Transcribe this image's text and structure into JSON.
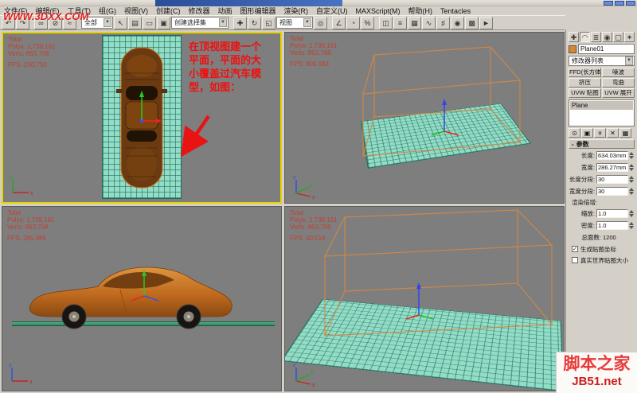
{
  "glyphs": {
    "dropdown_arrow": "▼"
  },
  "watermarks": {
    "top": "WWW.3DXX.COM",
    "bottom_title": "脚本之家",
    "bottom_sub": "JB51.net"
  },
  "menubar": {
    "items": [
      "文件(F)",
      "编辑(E)",
      "工具(T)",
      "组(G)",
      "视图(V)",
      "创建(C)",
      "修改器",
      "动画",
      "图形编辑器",
      "渲染(R)",
      "自定义(U)",
      "MAXScript(M)",
      "帮助(H)",
      "Tentacles"
    ]
  },
  "toolbar": {
    "selection_filter_value": "全部",
    "named_sets_placeholder": "创建选择集",
    "ref_coord_value": "视图",
    "icons": [
      {
        "name": "undo-icon",
        "glyph": "↶"
      },
      {
        "name": "redo-icon",
        "glyph": "↷"
      },
      {
        "name": "select-and-link-icon",
        "glyph": "∞"
      },
      {
        "name": "unlink-selection-icon",
        "glyph": "⊘"
      },
      {
        "name": "bind-to-space-warp-icon",
        "glyph": "≈"
      },
      {
        "name": "select-object-icon",
        "glyph": "↖"
      },
      {
        "name": "select-by-name-icon",
        "glyph": "▤"
      },
      {
        "name": "rectangular-selection-icon",
        "glyph": "▭"
      },
      {
        "name": "window-crossing-icon",
        "glyph": "▣"
      },
      {
        "name": "select-and-move-icon",
        "glyph": "✚"
      },
      {
        "name": "select-and-rotate-icon",
        "glyph": "↻"
      },
      {
        "name": "select-and-scale-icon",
        "glyph": "◱"
      },
      {
        "name": "use-pivot-center-icon",
        "glyph": "◎"
      },
      {
        "name": "snap-toggle-icon",
        "glyph": "∠"
      },
      {
        "name": "angle-snap-icon",
        "glyph": "◔"
      },
      {
        "name": "percent-snap-icon",
        "glyph": "%"
      },
      {
        "name": "mirror-icon",
        "glyph": "◫"
      },
      {
        "name": "align-icon",
        "glyph": "≡"
      },
      {
        "name": "layer-manager-icon",
        "glyph": "▦"
      },
      {
        "name": "curve-editor-icon",
        "glyph": "∿"
      },
      {
        "name": "schematic-view-icon",
        "glyph": "♯"
      },
      {
        "name": "material-editor-icon",
        "glyph": "◉"
      },
      {
        "name": "render-setup-icon",
        "glyph": "▩"
      },
      {
        "name": "quick-render-icon",
        "glyph": "►"
      }
    ]
  },
  "viewports": {
    "top": {
      "stats": [
        "Total",
        "Polys: 1,739,161",
        "Verts: 863,708"
      ],
      "fps": "FPS: 200.750",
      "annotation": [
        "在顶视图建一个",
        "平面，平面的大",
        "小覆盖过汽车模",
        "型，如图："
      ]
    },
    "perspective_upper": {
      "stats": [
        "Total",
        "Polys: 1,739,161",
        "Verts: 863,708"
      ],
      "fps": "FPS: 800.983"
    },
    "left": {
      "stats": [
        "Total",
        "Polys: 1,739,161",
        "Verts: 863,708"
      ],
      "fps": "FPS: 285.985"
    },
    "perspective_lower": {
      "stats": [
        "Total",
        "Polys: 1,739,161",
        "Verts: 863,708"
      ],
      "fps": "FPS: 40.518"
    }
  },
  "command_panel": {
    "tabs": [
      {
        "name": "create-tab-icon",
        "glyph": "✚"
      },
      {
        "name": "modify-tab-icon",
        "glyph": "◠"
      },
      {
        "name": "hierarchy-tab-icon",
        "glyph": "≣"
      },
      {
        "name": "motion-tab-icon",
        "glyph": "◉"
      },
      {
        "name": "display-tab-icon",
        "glyph": "▢"
      },
      {
        "name": "utilities-tab-icon",
        "glyph": "✶"
      }
    ],
    "object_name": "Plane01",
    "modifier_list_label": "修改器列表",
    "modifier_buttons": [
      "FFD(长方体)",
      "噪波",
      "挤压",
      "弯曲",
      "UVW 贴图",
      "UVW 展开"
    ],
    "stack_items": [
      "Plane"
    ],
    "stack_tools": [
      {
        "name": "pin-stack-icon",
        "glyph": "⊙"
      },
      {
        "name": "show-end-result-icon",
        "glyph": "▣"
      },
      {
        "name": "make-unique-icon",
        "glyph": "¤"
      },
      {
        "name": "remove-modifier-icon",
        "glyph": "✕"
      },
      {
        "name": "configure-modifier-sets-icon",
        "glyph": "▦"
      }
    ],
    "rollout_collapse_glyph": "-",
    "params": {
      "title": "参数",
      "rows": [
        {
          "label": "长度:",
          "value": "634.03mm"
        },
        {
          "label": "宽度:",
          "value": "286.27mm"
        },
        {
          "label": "长度分段:",
          "value": "30"
        },
        {
          "label": "宽度分段:",
          "value": "30"
        }
      ],
      "render_mult_label": "渲染倍增:",
      "mult_rows": [
        {
          "label": "缩放:",
          "value": "1.0"
        },
        {
          "label": "密度:",
          "value": "1.0"
        }
      ],
      "total_faces_label": "总面数:",
      "total_faces_value": "1200",
      "checkboxes": [
        {
          "label": "生成贴图坐标",
          "mark": "✓"
        },
        {
          "label": "真实世界贴图大小",
          "mark": ""
        }
      ]
    }
  }
}
